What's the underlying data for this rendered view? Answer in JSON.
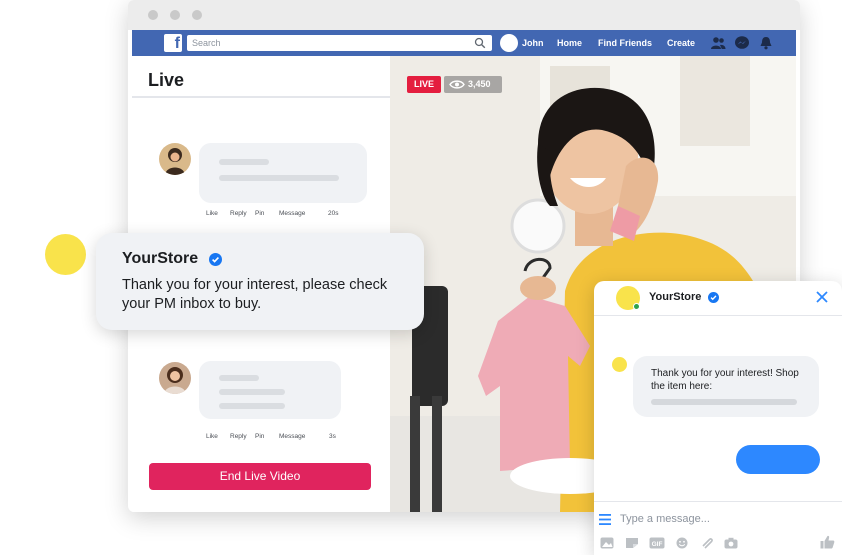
{
  "navbar": {
    "logo": "f",
    "search_placeholder": "Search",
    "user_name": "John",
    "links": [
      "Home",
      "Find Friends",
      "Create"
    ]
  },
  "live_panel": {
    "title": "Live",
    "comments": [
      {
        "actions": [
          "Like",
          "Reply",
          "Pin",
          "Message"
        ],
        "time": "20s"
      },
      {
        "actions": [
          "Like",
          "Reply",
          "Pin",
          "Message"
        ],
        "time": "3s"
      }
    ],
    "end_button": "End Live Video"
  },
  "video": {
    "live_label": "LIVE",
    "viewers": "3,450"
  },
  "notification": {
    "store_name": "YourStore",
    "message": "Thank you for your interest, please check your PM inbox to buy."
  },
  "messenger": {
    "store_name": "YourStore",
    "message": "Thank you for your interest! Shop the item here:",
    "input_placeholder": "Type a message...",
    "toolbar_icons": [
      "photo-icon",
      "sticker-icon",
      "gif-icon",
      "emoji-icon",
      "attachment-icon",
      "camera-icon",
      "thumbs-up-icon"
    ]
  },
  "colors": {
    "facebook_blue": "#4267b2",
    "live_red": "#e41e3f",
    "end_button": "#e0245e",
    "messenger_blue": "#2d88ff",
    "accent_yellow": "#f9e34b"
  }
}
